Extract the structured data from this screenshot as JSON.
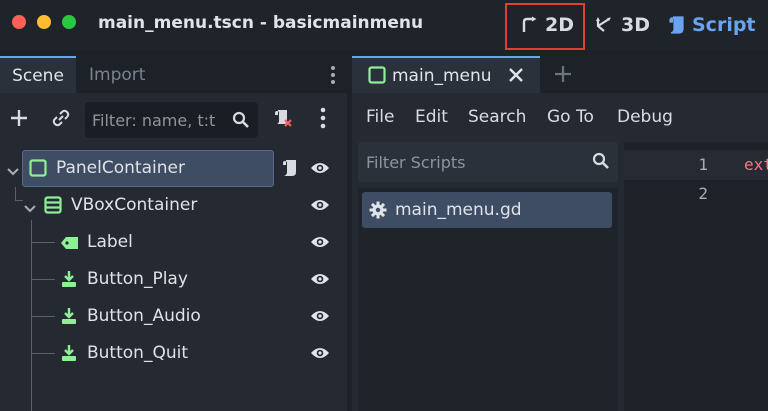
{
  "window": {
    "title": "main_menu.tscn - basicmainmenu"
  },
  "modes": {
    "two_d": "2D",
    "three_d": "3D",
    "script": "Script"
  },
  "left_dock": {
    "tabs": [
      "Scene",
      "Import"
    ],
    "filter_placeholder": "Filter: name, t:t"
  },
  "scene_tree": {
    "nodes": [
      {
        "label": "PanelContainer"
      },
      {
        "label": "VBoxContainer"
      },
      {
        "label": "Label"
      },
      {
        "label": "Button_Play"
      },
      {
        "label": "Button_Audio"
      },
      {
        "label": "Button_Quit"
      }
    ]
  },
  "editor": {
    "tab_label": "main_menu",
    "menu": [
      "File",
      "Edit",
      "Search",
      "Go To",
      "Debug"
    ],
    "script_filter_placeholder": "Filter Scripts",
    "scripts": [
      "main_menu.gd"
    ],
    "lines": [
      {
        "number": "1",
        "text": "ext"
      },
      {
        "number": "2",
        "text": ""
      }
    ]
  },
  "colors": {
    "accent": "#6aa4ee",
    "highlight_box": "#e0412f",
    "node_green": "#8eef97",
    "selection": "#3e4d63"
  }
}
